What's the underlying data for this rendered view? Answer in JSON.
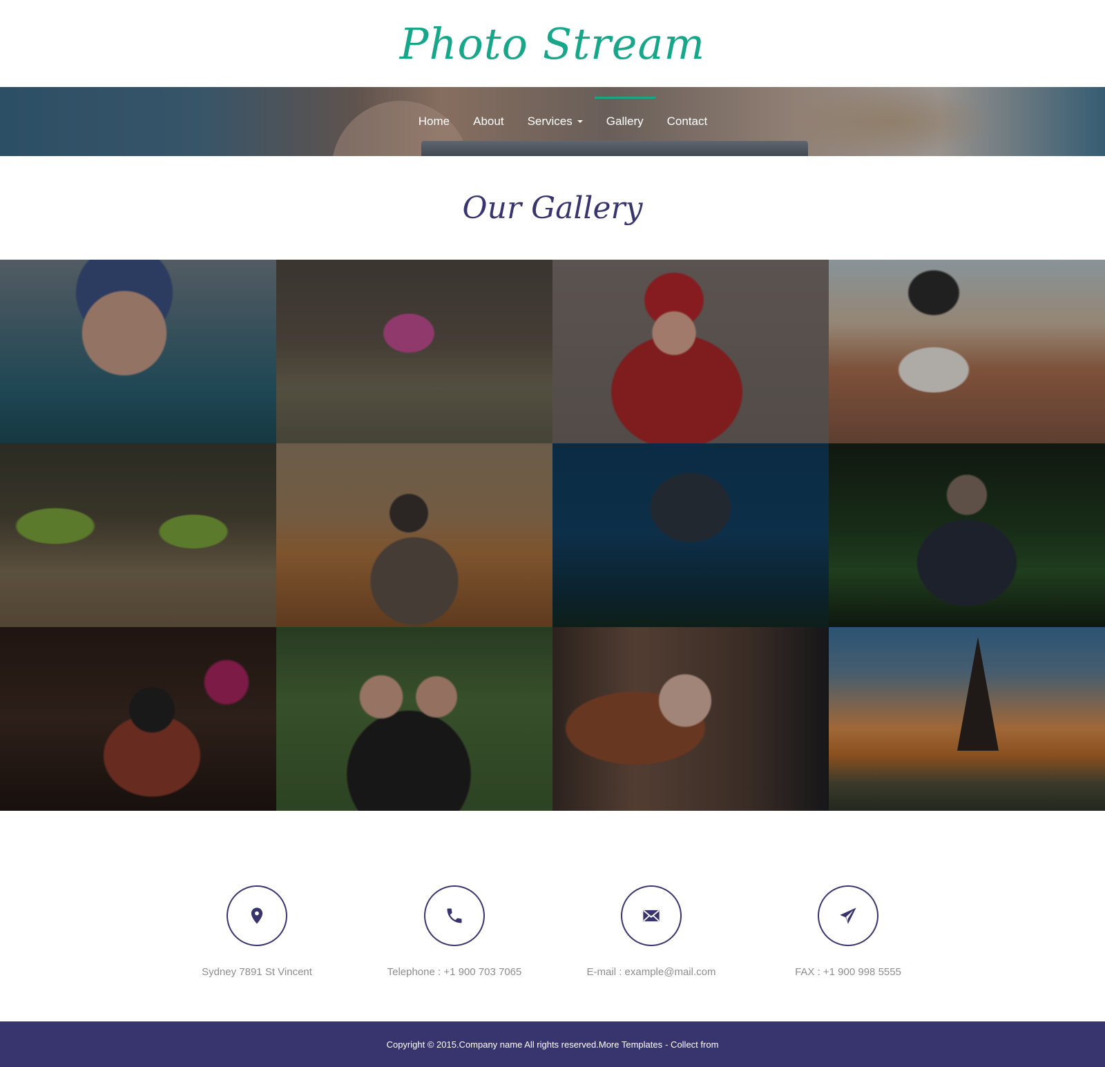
{
  "brand": {
    "title": "Photo Stream",
    "color": "#17a689"
  },
  "nav": {
    "items": [
      {
        "label": "Home"
      },
      {
        "label": "About"
      },
      {
        "label": "Services"
      },
      {
        "label": "Gallery",
        "active": true
      },
      {
        "label": "Contact"
      }
    ],
    "accent": "#17a689"
  },
  "gallery": {
    "title": "Our Gallery",
    "tiles": [
      "child-in-winter-hat",
      "girl-pink-jacket-field",
      "woman-red-hat-blowing-kiss",
      "woman-photographer-rooftops",
      "toy-frogs-with-cameras",
      "man-photographer-ballroom",
      "underwater-diver-photographer",
      "man-with-camera-in-boat",
      "woman-with-camera-party",
      "two-women-vintage-camera",
      "woman-sunglasses-portrait",
      "eiffel-tower-sunset"
    ]
  },
  "contact": {
    "items": [
      {
        "icon": "map-pin-icon",
        "text": "Sydney 7891 St Vincent"
      },
      {
        "icon": "phone-icon",
        "text": "Telephone : +1 900 703 7065"
      },
      {
        "icon": "envelope-icon",
        "text": "E-mail : example@mail.com"
      },
      {
        "icon": "paper-plane-icon",
        "text": "FAX : +1 900 998 5555"
      }
    ],
    "icon_color": "#37346e"
  },
  "footer": {
    "copyright": "Copyright © 2015.Company name All rights reserved.More Templates",
    "collect": "- Collect from",
    "background": "#37346e"
  }
}
